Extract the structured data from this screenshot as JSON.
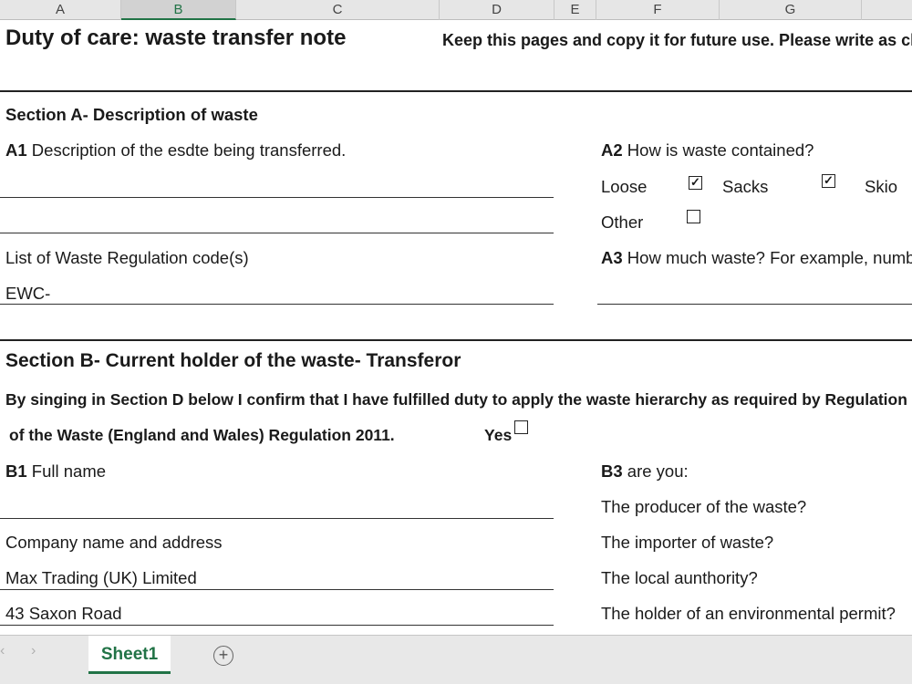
{
  "columns": [
    "A",
    "B",
    "C",
    "D",
    "E",
    "F",
    "G"
  ],
  "form": {
    "title": "Duty of care: waste transfer note",
    "instructions": "Keep this pages and copy it for future use. Please write as clea",
    "section_a": {
      "heading": "Section A- Description of waste",
      "a1_label": "A1",
      "a1_text": " Description of the esdte being transferred.",
      "a2_label": "A2",
      "a2_text": " How is waste contained?",
      "loose": "Loose",
      "sacks": "Sacks",
      "skip": "Skio",
      "other": "Other",
      "check_mark": "✓",
      "codes_label": "List of Waste Regulation code(s)",
      "ewc": "EWC-",
      "a3_label": "A3",
      "a3_text": " How much waste? For example, number o"
    },
    "section_b": {
      "heading": "Section B- Current holder of the waste- Transferor",
      "confirm_line1": "By singing in Section D below I confirm that I have fulfilled duty to apply the waste hierarchy as required by Regulation",
      "confirm_line2": "of the Waste (England and Wales) Regulation 2011.",
      "yes": "Yes",
      "b1_label": "B1",
      "b1_text": " Full name",
      "company_label": "Company name and address",
      "company_line1": "Max Trading (UK) Limited",
      "company_line2": "43 Saxon Road",
      "b3_label": "B3",
      "b3_text": " are you:",
      "b3_options": [
        "The producer of the waste?",
        "The importer of waste?",
        "The local aunthority?",
        "The holder of an environmental permit?"
      ]
    }
  },
  "tabs": {
    "sheet_name": "Sheet1",
    "prev_arrow": "‹",
    "next_arrow": "›",
    "add_symbol": "+"
  }
}
